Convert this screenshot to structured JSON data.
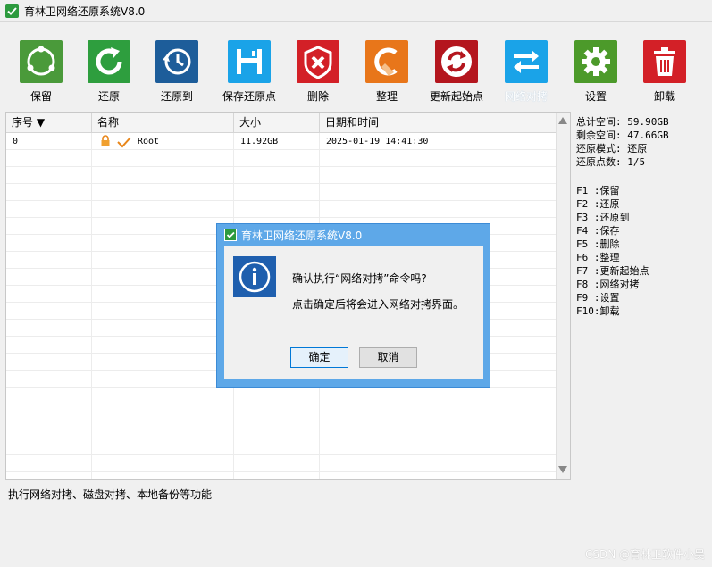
{
  "app": {
    "title": "育林卫网络还原系统V8.0"
  },
  "toolbar": {
    "items": [
      {
        "label": "保留",
        "icon": "save-point-icon",
        "color": "#4a9a3a"
      },
      {
        "label": "还原",
        "icon": "restore-icon",
        "color": "#2e9e3e"
      },
      {
        "label": "还原到",
        "icon": "history-icon",
        "color": "#1d5d9a"
      },
      {
        "label": "保存还原点",
        "icon": "floppy-icon",
        "color": "#1aa3e8"
      },
      {
        "label": "删除",
        "icon": "delete-icon",
        "color": "#d32027"
      },
      {
        "label": "整理",
        "icon": "broom-icon",
        "color": "#e8761a"
      },
      {
        "label": "更新起始点",
        "icon": "refresh-icon",
        "color": "#b4161e"
      },
      {
        "label": "网络对拷",
        "icon": "transfer-icon",
        "color": "#1aa3e8"
      },
      {
        "label": "设置",
        "icon": "gear-icon",
        "color": "#4c9a2a"
      },
      {
        "label": "卸载",
        "icon": "trash-icon",
        "color": "#d32027"
      }
    ]
  },
  "table": {
    "headers": [
      "序号 ▼",
      "名称",
      "大小",
      "日期和时间"
    ],
    "rows": [
      {
        "index": "0",
        "name": "Root",
        "size": "11.92GB",
        "datetime": "2025-01-19 14:41:30"
      }
    ]
  },
  "info": {
    "total": "总计空间: 59.90GB",
    "free": "剩余空间: 47.66GB",
    "mode": "还原模式: 还原",
    "points": "还原点数: 1/5"
  },
  "shortcuts": [
    "F1 :保留",
    "F2 :还原",
    "F3 :还原到",
    "F4 :保存",
    "F5 :删除",
    "F6 :整理",
    "F7 :更新起始点",
    "F8 :网络对拷",
    "F9 :设置",
    "F10:卸载"
  ],
  "status": "执行网络对拷、磁盘对拷、本地备份等功能",
  "watermark": "CSDN @育林卫软件小吴",
  "dialog": {
    "title": "育林卫网络还原系统V8.0",
    "message1": "确认执行“网络对拷”命令吗?",
    "message2": "点击确定后将会进入网络对拷界面。",
    "ok": "确定",
    "cancel": "取消"
  }
}
